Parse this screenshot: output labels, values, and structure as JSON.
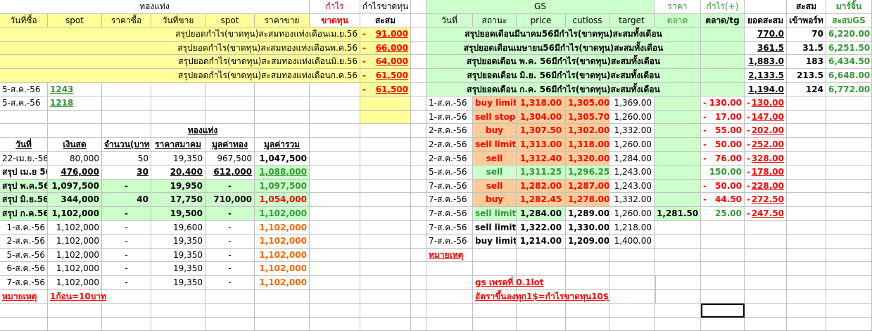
{
  "left": {
    "title": "ทองแท่ง",
    "profit_label": "กำไร",
    "cum_label": "กำไรขาดทุน",
    "headers": [
      "วันที่ซื้อ",
      "spot",
      "ราคาซื้อ",
      "วันที่ขาย",
      "spot",
      "ราคาขาย",
      "ขาดทุน",
      "สะสม"
    ],
    "summary_rows": [
      {
        "text": "สรุปยอดกำไร(ขาดทุน)สะสมทองแท่งเดือนเม.ย.56",
        "minus": "-",
        "value": "91,000"
      },
      {
        "text": "สรุปยอดกำไร(ขาดทุน)สะสมทองแท่งเดือนพ.ค.56",
        "minus": "-",
        "value": "66,000"
      },
      {
        "text": "สรุปยอดกำไร(ขาดทุน)สะสมทองแท่งเดือนมิ.ย.56",
        "minus": "-",
        "value": "64,000"
      },
      {
        "text": "สรุปยอดกำไร(ขาดทุน)สะสมทองแท่งเดือนก.ค.56",
        "minus": "-",
        "value": "61,500"
      }
    ],
    "trade_rows": [
      {
        "date": "5-ส.ค.-56",
        "spot": "1243",
        "minus": "-",
        "value": "61,500"
      },
      {
        "date": "5-ส.ค.-56",
        "spot": "1218",
        "minus": "",
        "value": ""
      }
    ],
    "gold_title": "ทองแท่ง",
    "gold_headers": [
      "วันที่",
      "เงินสด",
      "จำนวน(บาท",
      "ราคาสมาคม",
      "มูลค่าทอง",
      "มูลค่ารวม"
    ],
    "gold_rows": [
      {
        "date": "22-เม.ย.-56",
        "cash": "80,000",
        "qty": "50",
        "price": "19,350",
        "gold": "967,500",
        "total": "1,047,500",
        "style": "plain"
      },
      {
        "date": "สรุป เม.ย 56",
        "cash": "476,000",
        "qty": "30",
        "price": "20,400",
        "gold": "612,000",
        "total": "1,088,000",
        "style": "sum1"
      },
      {
        "date": "สรุป พ.ค.56",
        "cash": "1,097,500",
        "qty": "-",
        "price": "19,950",
        "gold": "-",
        "total": "1,097,500",
        "style": "sum"
      },
      {
        "date": "สรุป มิ.ย.56",
        "cash": "344,000",
        "qty": "40",
        "price": "17,750",
        "gold": "710,000",
        "total": "1,054,000",
        "style": "sumred"
      },
      {
        "date": "สรุป ก.ค.56",
        "cash": "1,102,000",
        "qty": "-",
        "price": "19,500",
        "gold": "-",
        "total": "1,102,000",
        "style": "sum"
      },
      {
        "date": "1-ส.ค.-56",
        "cash": "1,102,000",
        "qty": "-",
        "price": "19,600",
        "gold": "-",
        "total": "1,102,000",
        "style": "day"
      },
      {
        "date": "2-ส.ค.-56",
        "cash": "1,102,000",
        "qty": "-",
        "price": "19,350",
        "gold": "-",
        "total": "1,102,000",
        "style": "day"
      },
      {
        "date": "5-ส.ค.-56",
        "cash": "1,102,000",
        "qty": "-",
        "price": "19,350",
        "gold": "-",
        "total": "1,102,000",
        "style": "day"
      },
      {
        "date": "6-ส.ค.-56",
        "cash": "1,102,000",
        "qty": "-",
        "price": "19,350",
        "gold": "-",
        "total": "1,102,000",
        "style": "day"
      },
      {
        "date": "7-ส.ค.-56",
        "cash": "1,102,000",
        "qty": "-",
        "price": "19,350",
        "gold": "-",
        "total": "1,102,000",
        "style": "day"
      }
    ],
    "note_label": "หมายเหตุ",
    "note_text": "1ก้อน=10บาท"
  },
  "right": {
    "gs_title": "GS",
    "price_label": "ราคา",
    "market_label": "ตลาด",
    "profit_plus": "กำไร(+)",
    "cum": "สะสม",
    "margin": "มาร์จิ้น",
    "headers": [
      "วันที่",
      "สถานะ",
      "price",
      "cutloss",
      "target",
      "ตลาด",
      "ตลาด/tg",
      "ยอดสะสม",
      "เข้าพอร์ท",
      "สะสมGS"
    ],
    "summary_rows": [
      {
        "text": "สรุปยอดเดือนมีนาคม56มีกำไร(ขาดทุน)สะสมทั้งเดือน",
        "cum": "770.0",
        "port": "70",
        "gs": "6,220.00"
      },
      {
        "text": "สรุปยอดเดือนเมษายน56มีกำไร(ขาดทุน)สะสมทั้งเดือน",
        "cum": "361.5",
        "port": "31.5",
        "gs": "6,251.50"
      },
      {
        "text": "สรุปยอดเดือน พ.ค. 56มีกำไร(ขาดทุน)สะสมทั้งเดือน",
        "cum": "1,883.0",
        "port": "183",
        "gs": "6,434.50"
      },
      {
        "text": "สรุปยอดเดือน มิ.ย. 56มีกำไร(ขาดทุน)สะสมทั้งเดือน",
        "cum": "2,133.5",
        "port": "213.5",
        "gs": "6,648.00"
      },
      {
        "text": "สรุปยอดเดือน ก.ค. 56มีกำไร(ขาดทุน)สะสมทั้งเดือน",
        "cum": "1,194.0",
        "port": "124",
        "gs": "6,772.00"
      }
    ],
    "trades": [
      {
        "date": "1-ส.ค.-56",
        "status": "buy limit",
        "price": "1,318.00",
        "cut": "1,305.00",
        "target": "1,369.00",
        "mkt": "",
        "pl": "130.00",
        "plneg": true,
        "cum": "130.00",
        "cumneg": true,
        "style": "org"
      },
      {
        "date": "1-ส.ค.-56",
        "status": "sell stop",
        "price": "1,304.00",
        "cut": "1,305.70",
        "target": "1,260.00",
        "mkt": "",
        "pl": "17.00",
        "plneg": true,
        "cum": "147.00",
        "cumneg": true,
        "style": "org"
      },
      {
        "date": "2-ส.ค.-56",
        "status": "buy",
        "price": "1,307.50",
        "cut": "1,302.00",
        "target": "1,332.00",
        "mkt": "",
        "pl": "55.00",
        "plneg": true,
        "cum": "202.00",
        "cumneg": true,
        "style": "org"
      },
      {
        "date": "2-ส.ค.-56",
        "status": "sell limit",
        "price": "1,313.00",
        "cut": "1,318.00",
        "target": "1,260.00",
        "mkt": "",
        "pl": "50.00",
        "plneg": true,
        "cum": "252.00",
        "cumneg": true,
        "style": "org"
      },
      {
        "date": "2-ส.ค.-56",
        "status": "sell",
        "price": "1,312.40",
        "cut": "1,320.00",
        "target": "1,284.00",
        "mkt": "",
        "pl": "76.00",
        "plneg": true,
        "cum": "328.00",
        "cumneg": true,
        "style": "org"
      },
      {
        "date": "5-ส.ค.-56",
        "status": "sell",
        "price": "1,311.25",
        "cut": "1,296.25",
        "target": "1,243.00",
        "mkt": "",
        "pl": "150.00",
        "plneg": false,
        "cum": "178.00",
        "cumneg": true,
        "style": "grn"
      },
      {
        "date": "7-ส.ค.-56",
        "status": "sell",
        "price": "1,282.00",
        "cut": "1,287.00",
        "target": "1,243.00",
        "mkt": "",
        "pl": "50.00",
        "plneg": true,
        "cum": "228.00",
        "cumneg": true,
        "style": "org"
      },
      {
        "date": "7-ส.ค.-56",
        "status": "buy",
        "price": "1,282.45",
        "cut": "1,278.00",
        "target": "1,332.00",
        "mkt": "",
        "pl": "44.50",
        "plneg": true,
        "cum": "272.50",
        "cumneg": true,
        "style": "org"
      },
      {
        "date": "7-ส.ค.-56",
        "status": "sell limit",
        "price": "1,284.00",
        "cut": "1,289.00",
        "target": "1,260.00",
        "mkt": "1,281.50",
        "pl": "25.00",
        "plneg": false,
        "cum": "247.50",
        "cumneg": true,
        "style": "grnlim"
      },
      {
        "date": "7-ส.ค.-56",
        "status": "sell limit",
        "price": "1,322.00",
        "cut": "1,330.00",
        "target": "1,218.00",
        "mkt": "",
        "pl": "",
        "plneg": false,
        "cum": "",
        "cumneg": false,
        "style": "plain"
      },
      {
        "date": "7-ส.ค.-56",
        "status": "buy limit",
        "price": "1,214.00",
        "cut": "1,209.00",
        "target": "1,400.00",
        "mkt": "",
        "pl": "",
        "plneg": false,
        "cum": "",
        "cumneg": false,
        "style": "plain"
      }
    ],
    "note_label": "หมายเหตุ",
    "note1": "gs เพรดที่ 0.1lot",
    "note2": "อัตราขึ้นลงทุก1$=กำไรขาดทุน10$"
  }
}
